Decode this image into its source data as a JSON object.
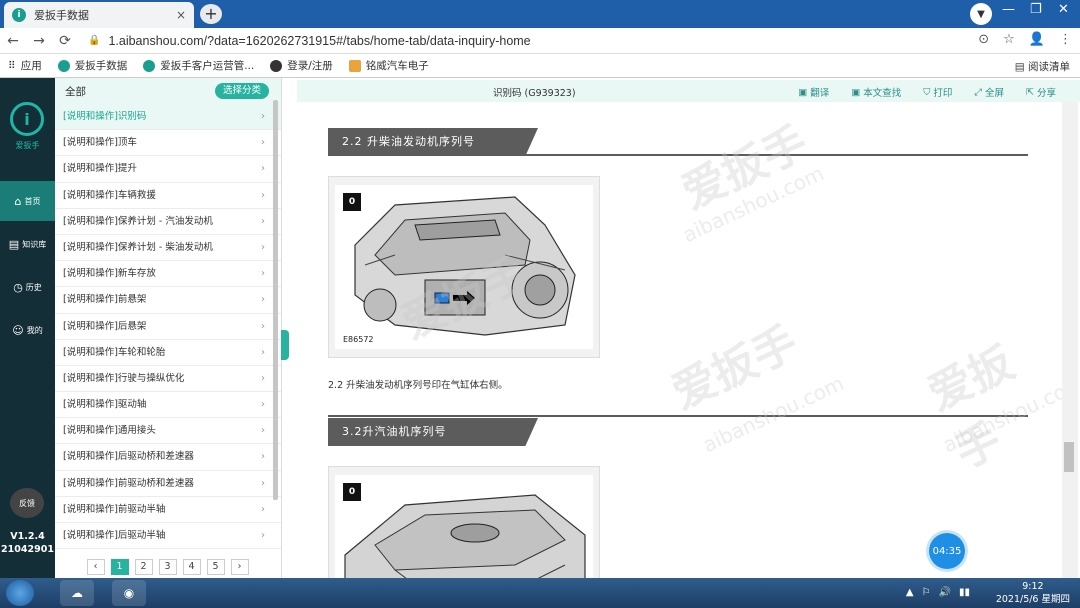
{
  "browser": {
    "tab_title": "爱扳手数据",
    "tab_icon": "i",
    "close_glyph": "×",
    "new_tab_glyph": "+",
    "window_controls": [
      "—",
      "❐",
      "✕"
    ],
    "url": "1.aibanshou.com/?data=1620262731915#/tabs/home-tab/data-inquiry-home",
    "nav_glyphs": [
      "←",
      "→",
      "⟳"
    ],
    "lock_glyph": "🔒",
    "url_right_glyphs": [
      "⊙",
      "☆",
      "👤",
      "⋮"
    ],
    "bookmarks": [
      {
        "icon": "apps-icon",
        "label": "应用"
      },
      {
        "icon": "aibanshou-icon",
        "label": "爱扳手数据"
      },
      {
        "icon": "aibanshou-icon",
        "label": "爱扳手客户运营管..."
      },
      {
        "icon": "globe-icon",
        "label": "登录/注册"
      },
      {
        "icon": "folder-icon",
        "label": "铭威汽车电子"
      }
    ],
    "reading_list": "阅读清单"
  },
  "app": {
    "logo_letter": "i",
    "logo_text": "爱扳手",
    "nav": [
      {
        "icon": "home-icon",
        "glyph": "⌂",
        "label": "首页"
      },
      {
        "icon": "book-icon",
        "glyph": "▤",
        "label": "知识库"
      },
      {
        "icon": "clock-icon",
        "glyph": "◷",
        "label": "历史"
      },
      {
        "icon": "user-icon",
        "glyph": "☺",
        "label": "我的"
      }
    ],
    "feedback": "反馈",
    "version": "V1.2.4",
    "build": "21042901"
  },
  "catalog": {
    "header": "全部",
    "select_button": "选择分类",
    "items": [
      "[说明和操作]识别码",
      "[说明和操作]顶车",
      "[说明和操作]提升",
      "[说明和操作]车辆救援",
      "[说明和操作]保养计划 - 汽油发动机",
      "[说明和操作]保养计划 - 柴油发动机",
      "[说明和操作]新车存放",
      "[说明和操作]前悬架",
      "[说明和操作]后悬架",
      "[说明和操作]车轮和轮胎",
      "[说明和操作]行驶与操纵优化",
      "[说明和操作]驱动轴",
      "[说明和操作]通用接头",
      "[说明和操作]后驱动桥和差速器",
      "[说明和操作]前驱动桥和差速器",
      "[说明和操作]前驱动半轴",
      "[说明和操作]后驱动半轴"
    ],
    "chevron": "›",
    "pager": {
      "prev": "‹",
      "pages": [
        "1",
        "2",
        "3",
        "4",
        "5"
      ],
      "next": "›"
    }
  },
  "document": {
    "title": "识别码 (G939323)",
    "actions": [
      {
        "icon": "translate-icon",
        "glyph": "▣",
        "label": "翻译"
      },
      {
        "icon": "search-doc-icon",
        "glyph": "▣",
        "label": "本文查找"
      },
      {
        "icon": "print-icon",
        "glyph": "⛉",
        "label": "打印"
      },
      {
        "icon": "fullscreen-icon",
        "glyph": "⤢",
        "label": "全屏"
      },
      {
        "icon": "share-icon",
        "glyph": "⇱",
        "label": "分享"
      }
    ],
    "section1": "2.2 升柴油发动机序列号",
    "figure1_tag": "0",
    "figure1_code": "E86572",
    "caption1": "2.2 升柴油发动机序列号印在气缸体右侧。",
    "section2": "3.2升汽油机序列号",
    "figure2_tag": "0",
    "watermark_text": "爱扳手",
    "watermark_url": "aibanshou.com"
  },
  "overlay": {
    "timer": "04:35"
  },
  "taskbar": {
    "time": "9:12",
    "date": "2021/5/6 星期四",
    "tray_glyphs": [
      "▲",
      "⚐",
      "🔊",
      "▮▮"
    ]
  }
}
